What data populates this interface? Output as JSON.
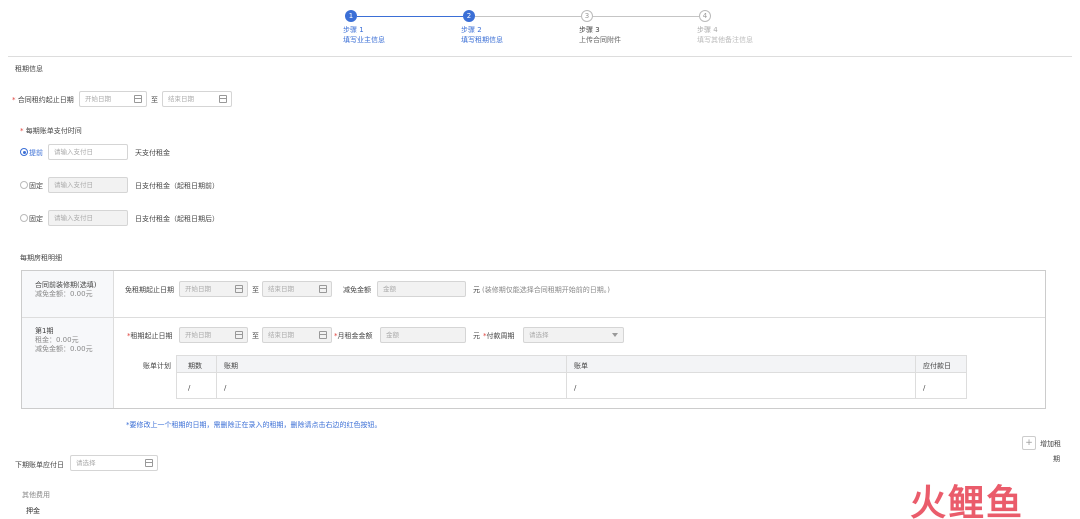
{
  "steps": [
    {
      "num": "1",
      "title": "步骤 1",
      "sub": "填写业主信息",
      "state": "done"
    },
    {
      "num": "2",
      "title": "步骤 2",
      "sub": "填写租期信息",
      "state": "active"
    },
    {
      "num": "3",
      "title": "步骤 3",
      "sub": "上传合同附件",
      "state": "pending"
    },
    {
      "num": "4",
      "title": "步骤 4",
      "sub": "填写其他备注信息",
      "state": "pending"
    }
  ],
  "section_lease": "租期信息",
  "contract_period": {
    "label": "合同租约起止日期",
    "start_placeholder": "开始日期",
    "to": "至",
    "end_placeholder": "结束日期"
  },
  "payment_time": {
    "label": "每期账单支付时间",
    "options": [
      {
        "label": "提前",
        "placeholder": "请输入支付日",
        "suffix": "天支付租金",
        "selected": true
      },
      {
        "label": "固定",
        "placeholder": "请输入支付日",
        "suffix": "日支付租金（起租日期前）",
        "selected": false
      },
      {
        "label": "固定",
        "placeholder": "请输入支付日",
        "suffix": "日支付租金（起租日期后）",
        "selected": false
      }
    ]
  },
  "detail_title": "每期房租明细",
  "renovation": {
    "title": "合同前装修期(选填)",
    "reduce": "减免金额：0.00元",
    "free_label": "免租期起止日期",
    "start_placeholder": "开始日期",
    "to": "至",
    "end_placeholder": "结束日期",
    "amount_label": "减免金额",
    "amount_placeholder": "金额",
    "unit": "元",
    "hint": "(装修期仅能选择合同租期开始前的日期。)"
  },
  "period1": {
    "title": "第1期",
    "rent": "租金：0.00元",
    "reduce": "减免金额：0.00元",
    "lease_label": "租期起止日期",
    "start_placeholder": "开始日期",
    "to": "至",
    "end_placeholder": "结束日期",
    "monthly_label": "月租金金额",
    "monthly_placeholder": "金额",
    "unit": "元",
    "cycle_label": "付款周期",
    "cycle_placeholder": "请选择",
    "bill_plan": "账单计划",
    "columns": [
      "期数",
      "账期",
      "账单",
      "应付款日"
    ],
    "row": [
      "/",
      "/",
      "/",
      "/"
    ]
  },
  "notice": "*要修改上一个租期的日期，需删除正在录入的租期，删除请点击右边的红色按钮。",
  "add_period": {
    "icon": "+",
    "line1": "增加租",
    "line2": "期"
  },
  "next_due": {
    "label": "下期账单应付日",
    "placeholder": "请选择"
  },
  "other_fees": "其他费用",
  "deposit": "押金",
  "logo_text": "火鲤鱼",
  "colors": {
    "accent": "#3b6fd6",
    "required": "#e0413a",
    "logo": "#e84b5c"
  }
}
